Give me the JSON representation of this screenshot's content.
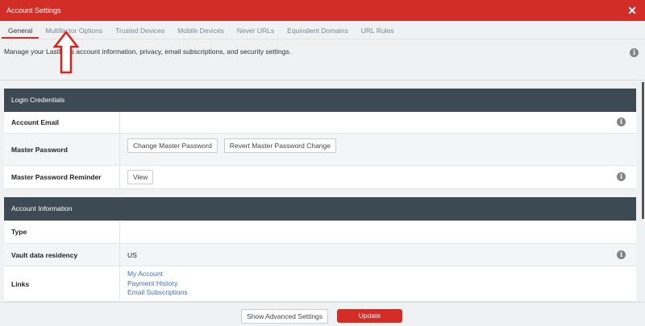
{
  "header": {
    "title": "Account Settings",
    "close_icon": "close-icon"
  },
  "tabs": [
    {
      "label": "General",
      "active": true
    },
    {
      "label": "Multifactor Options"
    },
    {
      "label": "Trusted Devices"
    },
    {
      "label": "Mobile Devices"
    },
    {
      "label": "Never URLs"
    },
    {
      "label": "Equivalent Domains"
    },
    {
      "label": "URL Rules"
    }
  ],
  "description": "Manage your LastPass account information, privacy, email subscriptions, and security settings.",
  "login": {
    "title": "Login Credentials",
    "email_label": "Account Email",
    "pw_label": "Master Password",
    "change_pw": "Change Master Password",
    "revert_pw": "Revert Master Password Change",
    "reminder_label": "Master Password Reminder",
    "view": "View"
  },
  "account": {
    "title": "Account Information",
    "type_label": "Type",
    "residency_label": "Vault data residency",
    "residency_value": "US",
    "links_label": "Links",
    "links": [
      "My Account",
      "Payment History",
      "Email Subscriptions"
    ]
  },
  "footer": {
    "advanced": "Show Advanced Settings",
    "update": "Update"
  },
  "colors": {
    "accent": "#d32d27",
    "section_header": "#3d4a53",
    "link": "#3b6fc4"
  },
  "info_icon_glyph": "i"
}
